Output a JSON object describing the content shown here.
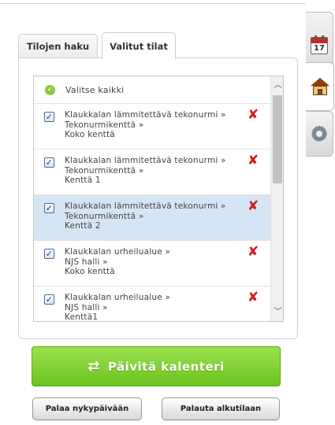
{
  "tabs": {
    "search": "Tilojen haku",
    "selected": "Valitut tilat"
  },
  "side_tabs": {
    "calendar_day": "17",
    "icons": [
      "calendar-icon",
      "house-icon",
      "gear-icon"
    ]
  },
  "list": {
    "select_all": "Valitse kaikki",
    "items": [
      {
        "line1": "Klaukkalan lämmitettävä tekonurmi »",
        "line2": "Tekonurmikenttä »",
        "line3": "Koko kenttä",
        "checked": true,
        "highlighted": false
      },
      {
        "line1": "Klaukkalan lämmitettävä tekonurmi »",
        "line2": "Tekonurmikenttä »",
        "line3": "Kenttä 1",
        "checked": true,
        "highlighted": false
      },
      {
        "line1": "Klaukkalan lämmitettävä tekonurmi »",
        "line2": "Tekonurmikenttä »",
        "line3": "Kenttä 2",
        "checked": true,
        "highlighted": true
      },
      {
        "line1": "Klaukkalan urheilualue »",
        "line2": "NJS halli »",
        "line3": "Koko kenttä",
        "checked": true,
        "highlighted": false
      },
      {
        "line1": "Klaukkalan urheilualue »",
        "line2": "NJS halli »",
        "line3": "Kenttä1",
        "checked": true,
        "highlighted": false
      }
    ]
  },
  "buttons": {
    "update_calendar": "Päivitä kalenteri",
    "back_to_today": "Palaa nykypäivään",
    "reset": "Palauta alkutilaan"
  },
  "colors": {
    "accent_green": "#7ccf2f",
    "delete_red": "#d41a1a",
    "highlight_row": "#d6e5f5"
  }
}
